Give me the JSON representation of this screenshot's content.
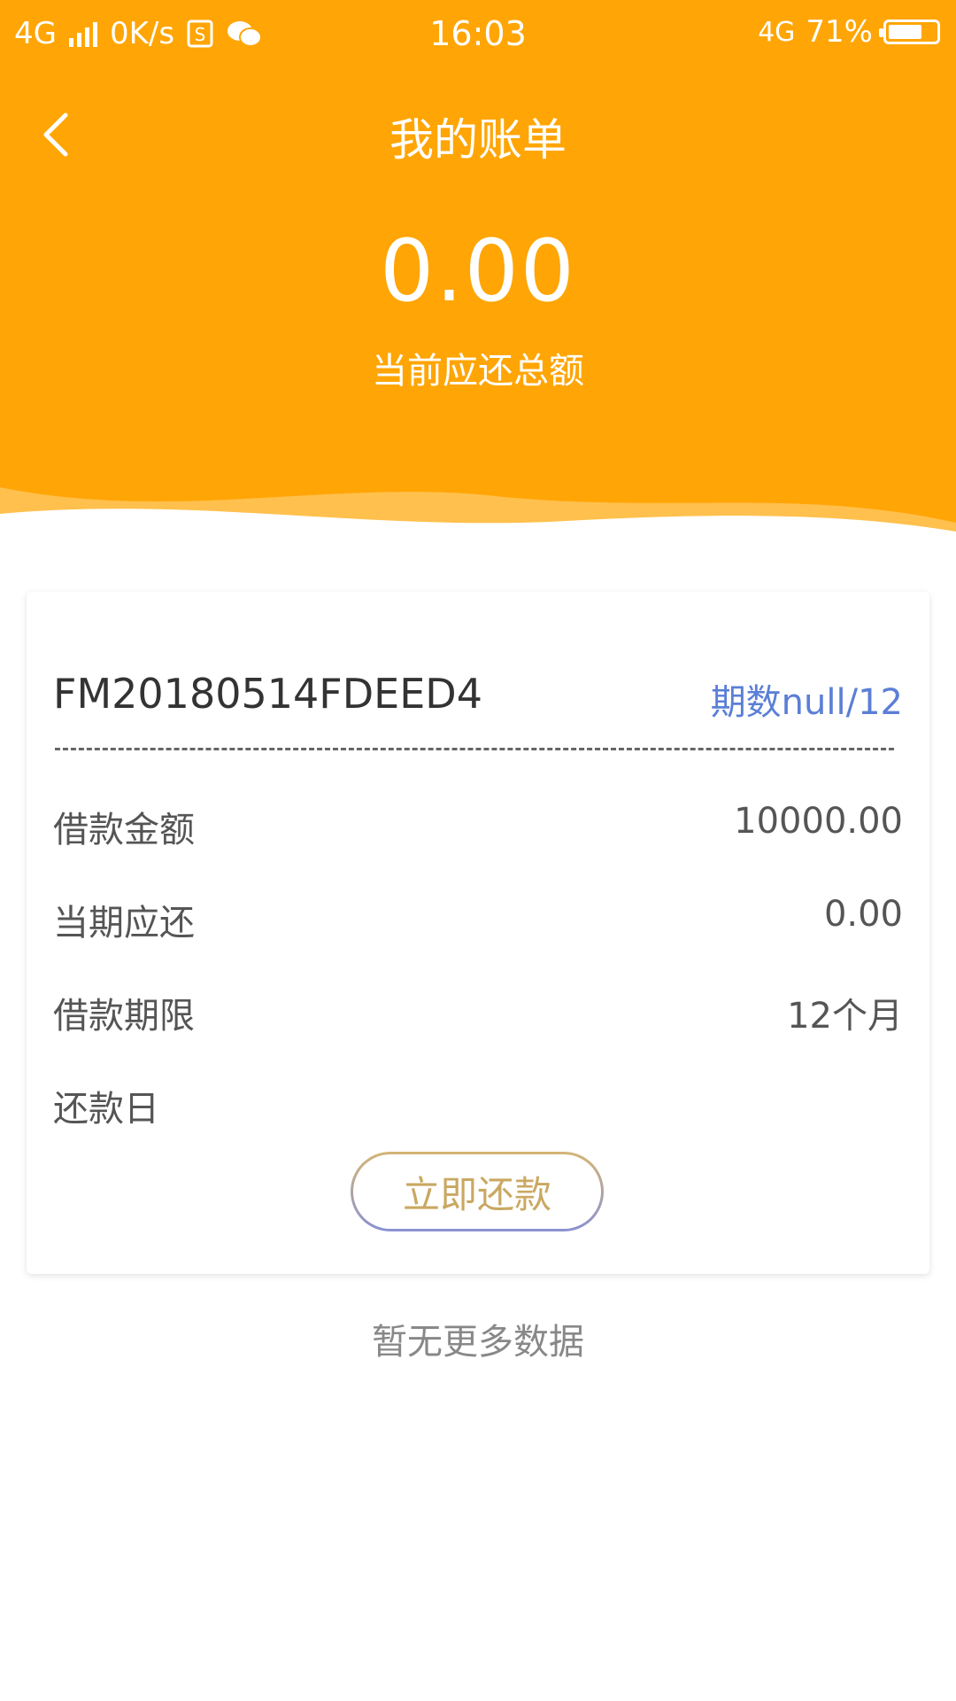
{
  "statusbar": {
    "network": "4G",
    "speed": "0K/s",
    "time": "16:03",
    "network_right": "4G",
    "battery_percent": "71%",
    "battery_level": 0.71
  },
  "nav": {
    "title": "我的账单",
    "back_icon": "chevron-left-icon"
  },
  "summary": {
    "amount": "0.00",
    "label": "当前应还总额"
  },
  "bill": {
    "order_no": "FM20180514FDEED4",
    "period": "期数null/12",
    "rows": [
      {
        "label": "借款金额",
        "value": "10000.00"
      },
      {
        "label": "当期应还",
        "value": "0.00"
      },
      {
        "label": "借款期限",
        "value": "12个月"
      },
      {
        "label": "还款日",
        "value": ""
      }
    ],
    "pay_button": "立即还款"
  },
  "footer": {
    "no_more": "暂无更多数据"
  },
  "colors": {
    "header": "#FFA505",
    "period_text": "#5B7FD6",
    "button_text": "#C9A862"
  }
}
